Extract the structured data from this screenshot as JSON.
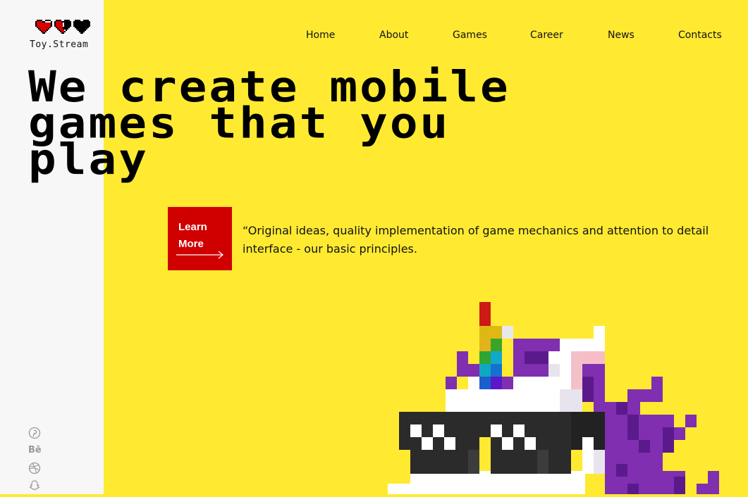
{
  "brand": {
    "name": "Toy.Stream"
  },
  "nav": {
    "items": [
      "Home",
      "About",
      "Games",
      "Career",
      "News",
      "Contacts"
    ]
  },
  "hero": {
    "headline_lines": [
      "We create mobile",
      "games that you",
      "play"
    ],
    "cta_label_line1": "Learn",
    "cta_label_line2": "More",
    "quote": "“Original ideas, quality implementation of game mechanics and attention to detail interface - our basic principles."
  },
  "socials": [
    {
      "icon": "pinterest-icon"
    },
    {
      "icon": "behance-icon",
      "text": "Bē"
    },
    {
      "icon": "dribbble-icon"
    },
    {
      "icon": "snapchat-icon"
    }
  ],
  "colors": {
    "background": "#ffea31",
    "sidebar": "#f7f7f7",
    "accent": "#d00000",
    "text": "#111111"
  }
}
